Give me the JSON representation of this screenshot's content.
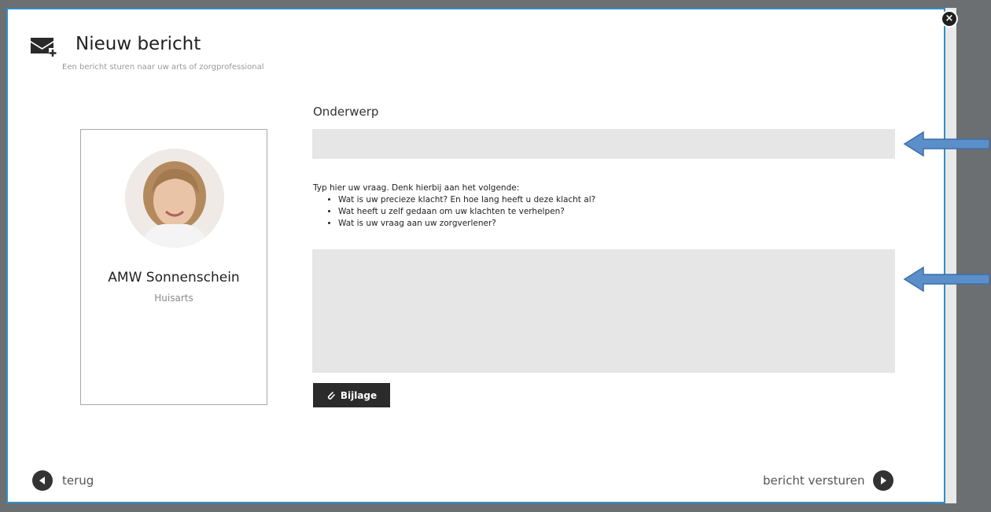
{
  "modal": {
    "title": "Nieuw bericht",
    "subtitle": "Een bericht sturen naar uw arts of zorgprofessional",
    "close_symbol": "×"
  },
  "doctor": {
    "name": "AMW Sonnenschein",
    "role": "Huisarts"
  },
  "form": {
    "subject_label": "Onderwerp",
    "subject_value": "",
    "instructions_intro": "Typ hier uw vraag. Denk hierbij aan het volgende:",
    "instructions_items": [
      "Wat is uw precieze klacht? En hoe lang heeft u deze klacht al?",
      "Wat heeft u zelf gedaan om uw klachten te verhelpen?",
      "Wat is uw vraag aan uw zorgverlener?"
    ],
    "message_value": "",
    "attach_label": "Bijlage"
  },
  "footer": {
    "back_label": "terug",
    "send_label": "bericht versturen"
  },
  "icons": {
    "mail": "mail-plus-icon",
    "close": "close-icon",
    "paperclip": "paperclip-icon",
    "back": "arrow-left-circle-icon",
    "send": "arrow-right-circle-icon"
  },
  "colors": {
    "modal_border": "#2f8fc7",
    "annotation_arrow": "#5b8fc9",
    "input_bg": "#e6e6e6",
    "button_bg": "#2b2b2b"
  }
}
